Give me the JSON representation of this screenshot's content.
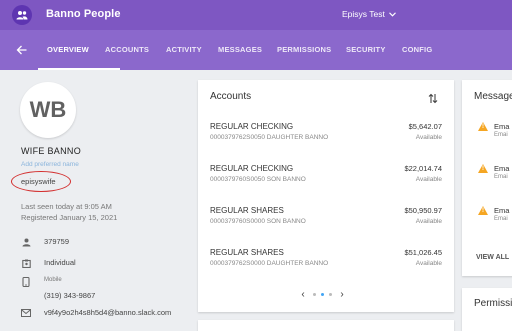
{
  "topbar": {
    "title": "Banno People",
    "institution": "Episys Test"
  },
  "nav": {
    "tabs": [
      "OVERVIEW",
      "ACCOUNTS",
      "ACTIVITY",
      "MESSAGES",
      "PERMISSIONS",
      "SECURITY",
      "CONFIG"
    ],
    "active_tab": "OVERVIEW"
  },
  "profile": {
    "initials": "WB",
    "name": "WIFE BANNO",
    "add_preferred_name": "Add preferred name",
    "username": "episyswife",
    "last_seen": "Last seen today at 9:05 AM",
    "registered": "Registered January 15, 2021",
    "member_number": "379759",
    "type": "Individual",
    "mobile_label": "Mobile",
    "mobile": "(319) 343-9867",
    "email": "v9f4y9o2h4s8h5d4@banno.slack.com"
  },
  "accounts": {
    "title": "Accounts",
    "items": [
      {
        "name": "REGULAR CHECKING",
        "sub": "0000379762S0050 DAUGHTER BANNO",
        "amount": "$5,642.07",
        "avail": "Available"
      },
      {
        "name": "REGULAR CHECKING",
        "sub": "0000379760S0050 SON BANNO",
        "amount": "$22,014.74",
        "avail": "Available"
      },
      {
        "name": "REGULAR SHARES",
        "sub": "0000379760S0000 SON BANNO",
        "amount": "$50,950.97",
        "avail": "Available"
      },
      {
        "name": "REGULAR SHARES",
        "sub": "0000379762S0000 DAUGHTER BANNO",
        "amount": "$51,026.45",
        "avail": "Available"
      }
    ]
  },
  "messages": {
    "title": "Messages",
    "items": [
      {
        "text": "Ema",
        "sub": "Emai"
      },
      {
        "text": "Ema",
        "sub": "Emai"
      },
      {
        "text": "Ema",
        "sub": "Emai"
      }
    ],
    "view_all": "VIEW ALL"
  },
  "permissions_card": {
    "title": "Permissions"
  },
  "colors": {
    "topbar": "#7e57c2",
    "navbar": "#8b68cc",
    "warning": "#f5a623",
    "annotation": "#d32f2f"
  },
  "icons": [
    "people-icon",
    "chevron-down-icon",
    "back-arrow-icon",
    "sort-icon",
    "person-icon",
    "badge-icon",
    "phone-icon",
    "email-icon",
    "warning-icon",
    "chevron-left-icon",
    "chevron-right-icon"
  ]
}
